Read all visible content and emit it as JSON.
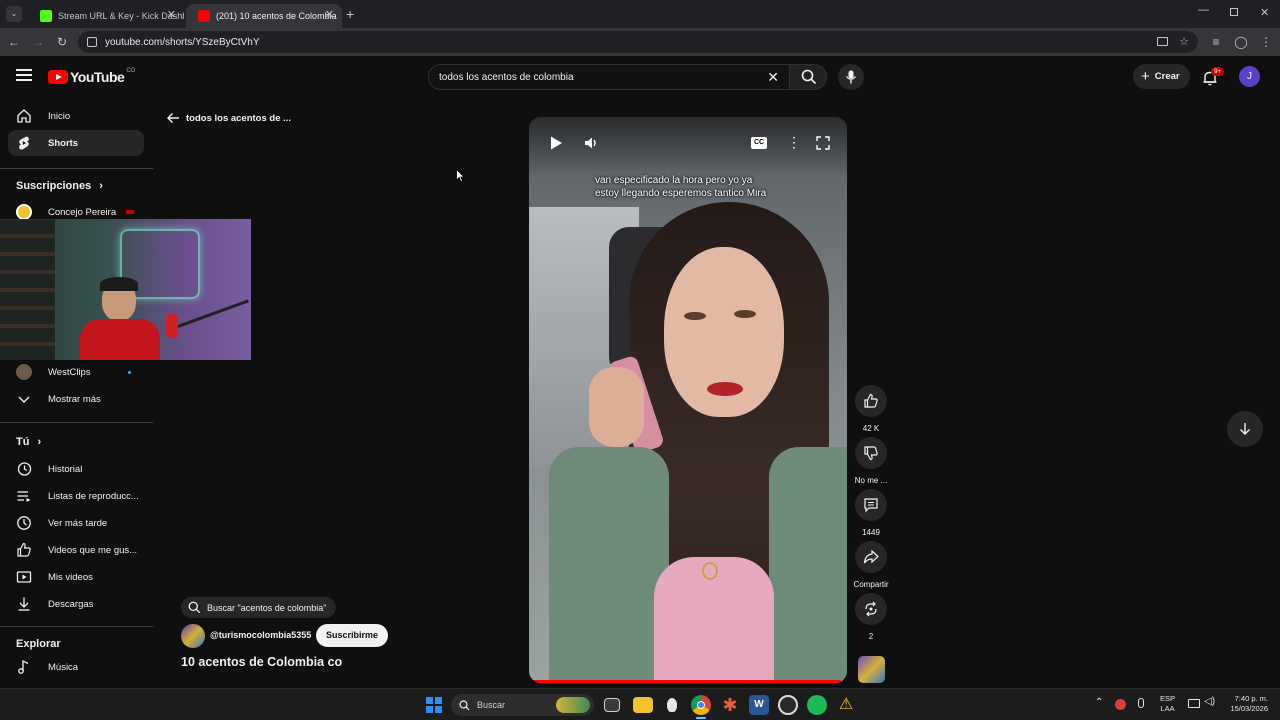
{
  "browser": {
    "tabs": [
      {
        "title": "Stream URL & Key - Kick Dashb",
        "favicon_color": "#53fc18"
      },
      {
        "title": "(201) 10 acentos de Colombia",
        "favicon_color": "#ff0000"
      }
    ],
    "url": "youtube.com/shorts/YSzeByCtVhY"
  },
  "youtube": {
    "logo_text": "YouTube",
    "country_code": "CO",
    "search_value": "todos los acentos de colombia",
    "create_label": "Crear",
    "notifications_badge": "9+",
    "avatar_letter": "J"
  },
  "sidebar": {
    "top_items": [
      {
        "label": "Inicio",
        "icon": "home-icon"
      },
      {
        "label": "Shorts",
        "icon": "shorts-icon"
      }
    ],
    "subscriptions_title": "Suscripciones",
    "subscriptions": [
      {
        "label": "Concejo Pereira"
      },
      {
        "label": "WestClips"
      }
    ],
    "show_more": "Mostrar más",
    "you_title": "Tú",
    "you_items": [
      {
        "label": "Historial",
        "icon": "history-icon"
      },
      {
        "label": "Listas de reproducc...",
        "icon": "playlists-icon"
      },
      {
        "label": "Ver más tarde",
        "icon": "watch-later-icon"
      },
      {
        "label": "Videos que me gus...",
        "icon": "like-icon"
      },
      {
        "label": "Mis videos",
        "icon": "my-videos-icon"
      },
      {
        "label": "Descargas",
        "icon": "download-icon"
      }
    ],
    "explore_title": "Explorar",
    "explore_items": [
      {
        "label": "Música",
        "icon": "music-icon"
      }
    ]
  },
  "shorts": {
    "back_label": "todos los acentos de ...",
    "caption_line1": "van especificado la hora pero yo ya",
    "caption_line2": "estoy llegando esperemos tantico Mira",
    "likes": "42 K",
    "dislike_label": "No me ...",
    "comments": "1449",
    "share_label": "Compartir",
    "remix_count": "2",
    "search_chip": "Buscar \"acentos de colombia\"",
    "channel": "@turismocolombia5355",
    "subscribe_label": "Suscribirme",
    "title": "10 acentos de Colombia co"
  },
  "taskbar": {
    "search_placeholder": "Buscar",
    "lang_line1": "ESP",
    "lang_line2": "LAA",
    "time": "7:40 p. m.",
    "date": "15/03/2026"
  },
  "colors": {
    "youtube_red": "#ff0000",
    "accent_purple": "#5c3fc9",
    "webcam_bg": "#6a4f8c"
  }
}
